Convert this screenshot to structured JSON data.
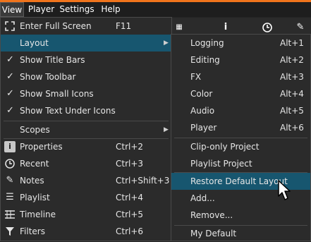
{
  "menubar": {
    "items": [
      {
        "label": "View"
      },
      {
        "label": "Player"
      },
      {
        "label": "Settings"
      },
      {
        "label": "Help"
      }
    ]
  },
  "view_menu": {
    "items": [
      {
        "label": "Enter Full Screen",
        "shortcut": "F11",
        "icon": "fullscreen-icon"
      },
      {
        "label": "Layout",
        "submenu": true,
        "highlighted": true
      },
      {
        "label": "Show Title Bars",
        "checked": true
      },
      {
        "label": "Show Toolbar",
        "checked": true
      },
      {
        "label": "Show Small Icons",
        "checked": true
      },
      {
        "label": "Show Text Under Icons",
        "checked": true
      },
      {
        "label": "Scopes",
        "submenu": true
      },
      {
        "label": "Properties",
        "shortcut": "Ctrl+2",
        "icon": "info-icon"
      },
      {
        "label": "Recent",
        "shortcut": "Ctrl+3",
        "icon": "clock-icon"
      },
      {
        "label": "Notes",
        "shortcut": "Ctrl+Shift+3",
        "icon": "notes-icon"
      },
      {
        "label": "Playlist",
        "shortcut": "Ctrl+4",
        "icon": "playlist-icon"
      },
      {
        "label": "Timeline",
        "shortcut": "Ctrl+5",
        "icon": "timeline-icon"
      },
      {
        "label": "Filters",
        "shortcut": "Ctrl+6",
        "icon": "filter-icon"
      }
    ]
  },
  "layout_menu": {
    "items": [
      {
        "label": "Logging",
        "shortcut": "Alt+1"
      },
      {
        "label": "Editing",
        "shortcut": "Alt+2"
      },
      {
        "label": "FX",
        "shortcut": "Alt+3"
      },
      {
        "label": "Color",
        "shortcut": "Alt+4"
      },
      {
        "label": "Audio",
        "shortcut": "Alt+5"
      },
      {
        "label": "Player",
        "shortcut": "Alt+6"
      },
      {
        "label": "Clip-only Project"
      },
      {
        "label": "Playlist Project"
      },
      {
        "label": "Restore Default Layout",
        "highlighted": true
      },
      {
        "label": "Add..."
      },
      {
        "label": "Remove..."
      },
      {
        "label": "My Default"
      }
    ]
  },
  "colors": {
    "accent": "#f0741c",
    "highlight": "#17566f",
    "menu_bg": "#2b2b2b"
  }
}
